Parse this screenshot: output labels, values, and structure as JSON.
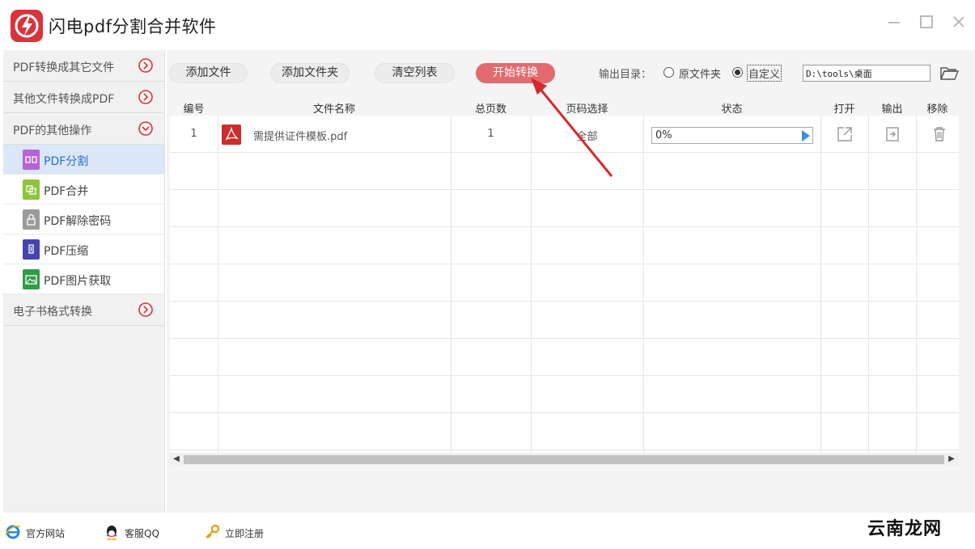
{
  "window": {
    "title": "闪电pdf分割合并软件",
    "controls": [
      "minimize",
      "maximize",
      "close"
    ],
    "accent": "#d9343c"
  },
  "sidebar": {
    "groups": [
      {
        "label": "PDF转换成其它文件",
        "state": "collapsed"
      },
      {
        "label": "其他文件转换成PDF",
        "state": "collapsed"
      },
      {
        "label": "PDF的其他操作",
        "state": "expanded"
      }
    ],
    "sub_items": [
      {
        "label": "PDF分割",
        "icon": "split-icon",
        "color": "#b563d8",
        "active": true
      },
      {
        "label": "PDF合并",
        "icon": "merge-icon",
        "color": "#8dc43c",
        "active": false
      },
      {
        "label": "PDF解除密码",
        "icon": "lock-icon",
        "color": "#9b9b9b",
        "active": false
      },
      {
        "label": "PDF压缩",
        "icon": "compress-icon",
        "color": "#4545b0",
        "active": false
      },
      {
        "label": "PDF图片获取",
        "icon": "image-icon",
        "color": "#2f9d45",
        "active": false
      }
    ],
    "bottom_group": {
      "label": "电子书格式转换",
      "state": "collapsed"
    }
  },
  "toolbar": {
    "add_file": "添加文件",
    "add_folder": "添加文件夹",
    "clear_list": "清空列表",
    "start_convert": "开始转换",
    "output_dir_label": "输出目录：",
    "radio_original": "原文件夹",
    "radio_custom": "自定义",
    "radio_selected": "custom",
    "output_path": "D:\\tools\\桌面"
  },
  "table": {
    "headers": [
      "编号",
      "文件名称",
      "总页数",
      "页码选择",
      "状态",
      "打开",
      "输出",
      "移除"
    ],
    "rows": [
      {
        "index": "1",
        "file_name": "需提供证件模板.pdf",
        "pages": "1",
        "page_selection": "全部",
        "status": "0%",
        "progress": 0
      }
    ]
  },
  "bottom_bar": {
    "website": "官方网站",
    "support": "客服QQ",
    "register": "立即注册"
  },
  "watermark": {
    "text": "云南龙网"
  }
}
